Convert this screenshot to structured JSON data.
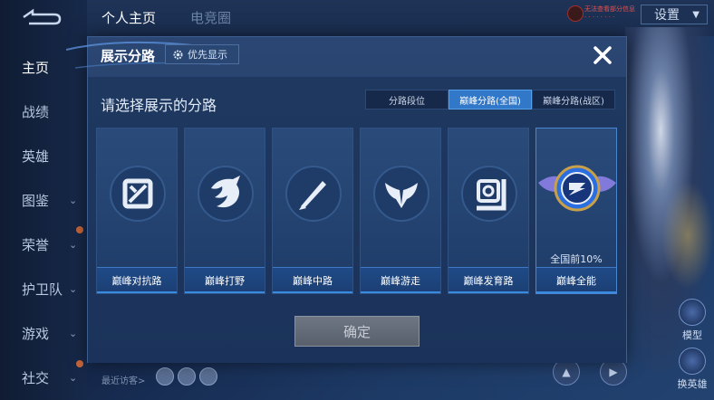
{
  "sidebar": {
    "items": [
      {
        "label": "主页",
        "has_chevron": false
      },
      {
        "label": "战绩",
        "has_chevron": false
      },
      {
        "label": "英雄",
        "has_chevron": false
      },
      {
        "label": "图鉴",
        "has_chevron": true
      },
      {
        "label": "荣誉",
        "has_chevron": true
      },
      {
        "label": "护卫队",
        "has_chevron": true
      },
      {
        "label": "游戏",
        "has_chevron": true
      },
      {
        "label": "社交",
        "has_chevron": true
      }
    ]
  },
  "topbar": {
    "tabs": [
      "个人主页",
      "电竞圈"
    ],
    "notice_line1": "无法查看部分信息",
    "notice_line2": "· · · · · · · ·",
    "settings_label": "设置"
  },
  "right_panel": {
    "model_label": "模型",
    "switch_hero_label": "换英雄"
  },
  "footer": {
    "recent_visitors_label": "最近访客>"
  },
  "modal": {
    "title": "展示分路",
    "priority_button_label": "优先显示",
    "prompt": "请选择展示的分路",
    "segments": [
      {
        "label": "分路段位",
        "active": false
      },
      {
        "label": "巅峰分路(全国)",
        "active": true
      },
      {
        "label": "巅峰分路(战区)",
        "active": false
      }
    ],
    "lanes": [
      {
        "name": "巅峰对抗路",
        "icon": "clash-lane-icon"
      },
      {
        "name": "巅峰打野",
        "icon": "jungle-icon"
      },
      {
        "name": "巅峰中路",
        "icon": "mid-lane-icon"
      },
      {
        "name": "巅峰游走",
        "icon": "roam-icon"
      },
      {
        "name": "巅峰发育路",
        "icon": "farm-lane-icon"
      },
      {
        "name": "巅峰全能",
        "icon": "all-round-icon",
        "rank_text": "全国前10%",
        "selected": true
      }
    ],
    "confirm_label": "确定"
  },
  "colors": {
    "accent_blue": "#3278c8",
    "panel": "#24406a",
    "confirm_disabled": "#606874"
  }
}
